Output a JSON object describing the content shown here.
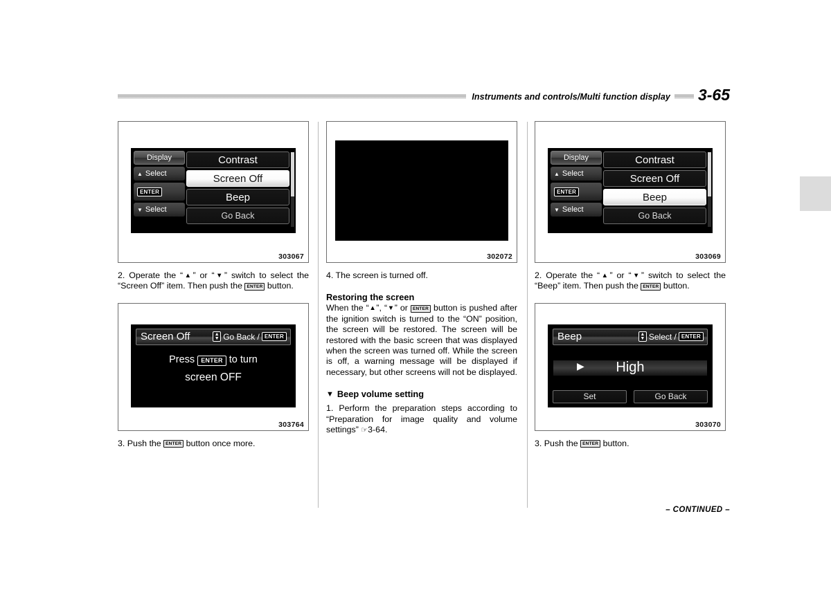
{
  "header": {
    "title": "Instruments and controls/Multi function display",
    "page_number": "3-65"
  },
  "footer": {
    "continued": "– CONTINUED –"
  },
  "figures": {
    "fig_303067": {
      "id": "303067",
      "soft_keys": [
        {
          "label": "Display",
          "icon": ""
        },
        {
          "label": "Select",
          "icon": "▲"
        },
        {
          "label": "ENTER",
          "icon": "enter-chip"
        },
        {
          "label": "Select",
          "icon": "▼"
        }
      ],
      "menu_items": [
        {
          "label": "Contrast",
          "selected": false
        },
        {
          "label": "Screen Off",
          "selected": true
        },
        {
          "label": "Beep",
          "selected": false
        },
        {
          "label": "Go Back",
          "selected": false
        }
      ]
    },
    "fig_302072": {
      "id": "302072",
      "content": ""
    },
    "fig_303069": {
      "id": "303069",
      "soft_keys": [
        {
          "label": "Display",
          "icon": ""
        },
        {
          "label": "Select",
          "icon": "▲"
        },
        {
          "label": "ENTER",
          "icon": "enter-chip"
        },
        {
          "label": "Select",
          "icon": "▼"
        }
      ],
      "menu_items": [
        {
          "label": "Contrast",
          "selected": false
        },
        {
          "label": "Screen Off",
          "selected": false
        },
        {
          "label": "Beep",
          "selected": true
        },
        {
          "label": "Go Back",
          "selected": false
        }
      ]
    },
    "fig_303764": {
      "id": "303764",
      "title": "Screen Off",
      "hint_label": "Go Back /",
      "hint_enter": "ENTER",
      "message_line1_a": "Press",
      "message_line1_enter": "ENTER",
      "message_line1_b": "to turn",
      "message_line2": "screen OFF"
    },
    "fig_303070": {
      "id": "303070",
      "title": "Beep",
      "hint_label": "Select /",
      "hint_enter": "ENTER",
      "value": "High",
      "caret": "▶",
      "buttons": [
        "Set",
        "Go Back"
      ]
    }
  },
  "column1": {
    "step2": {
      "num": "2.",
      "a": " Operate the “",
      "up": "▲",
      "b": "” or “",
      "dn": "▼",
      "c": "” switch to select the “Screen Off” item. Then push the ",
      "enter": "ENTER",
      "d": " button."
    },
    "step3": {
      "num": "3.",
      "a": " Push the ",
      "enter": "ENTER",
      "b": " button once more."
    }
  },
  "column2": {
    "step4": {
      "num": "4.",
      "text": " The screen is turned off."
    },
    "restoring": {
      "heading": "Restoring the screen",
      "a": "When the “",
      "up": "▲",
      "b": "”, “",
      "dn": "▼",
      "c": "” or ",
      "enter": "ENTER",
      "d": " button is pushed after the ignition switch is turned to the “ON” position, the screen will be restored. The screen will be restored with the basic screen that was displayed when the screen was turned off. While the screen is off, a warning message will be displayed if necessary, but other screens will not be displayed."
    },
    "beep_section": {
      "triangle": "▼",
      "heading": "Beep volume setting",
      "step1_num": "1.",
      "step1_a": " Perform the preparation steps according to “Preparation for image quality and volume settings” ",
      "step1_hand": "☞",
      "step1_ref": "3-64."
    }
  },
  "column3": {
    "step2": {
      "num": "2.",
      "a": " Operate the “",
      "up": "▲",
      "b": "” or “",
      "dn": "▼",
      "c": "” switch to select the “Beep” item. Then push the ",
      "enter": "ENTER",
      "d": " button."
    },
    "step3": {
      "num": "3.",
      "a": " Push the ",
      "enter": "ENTER",
      "b": " button."
    }
  }
}
